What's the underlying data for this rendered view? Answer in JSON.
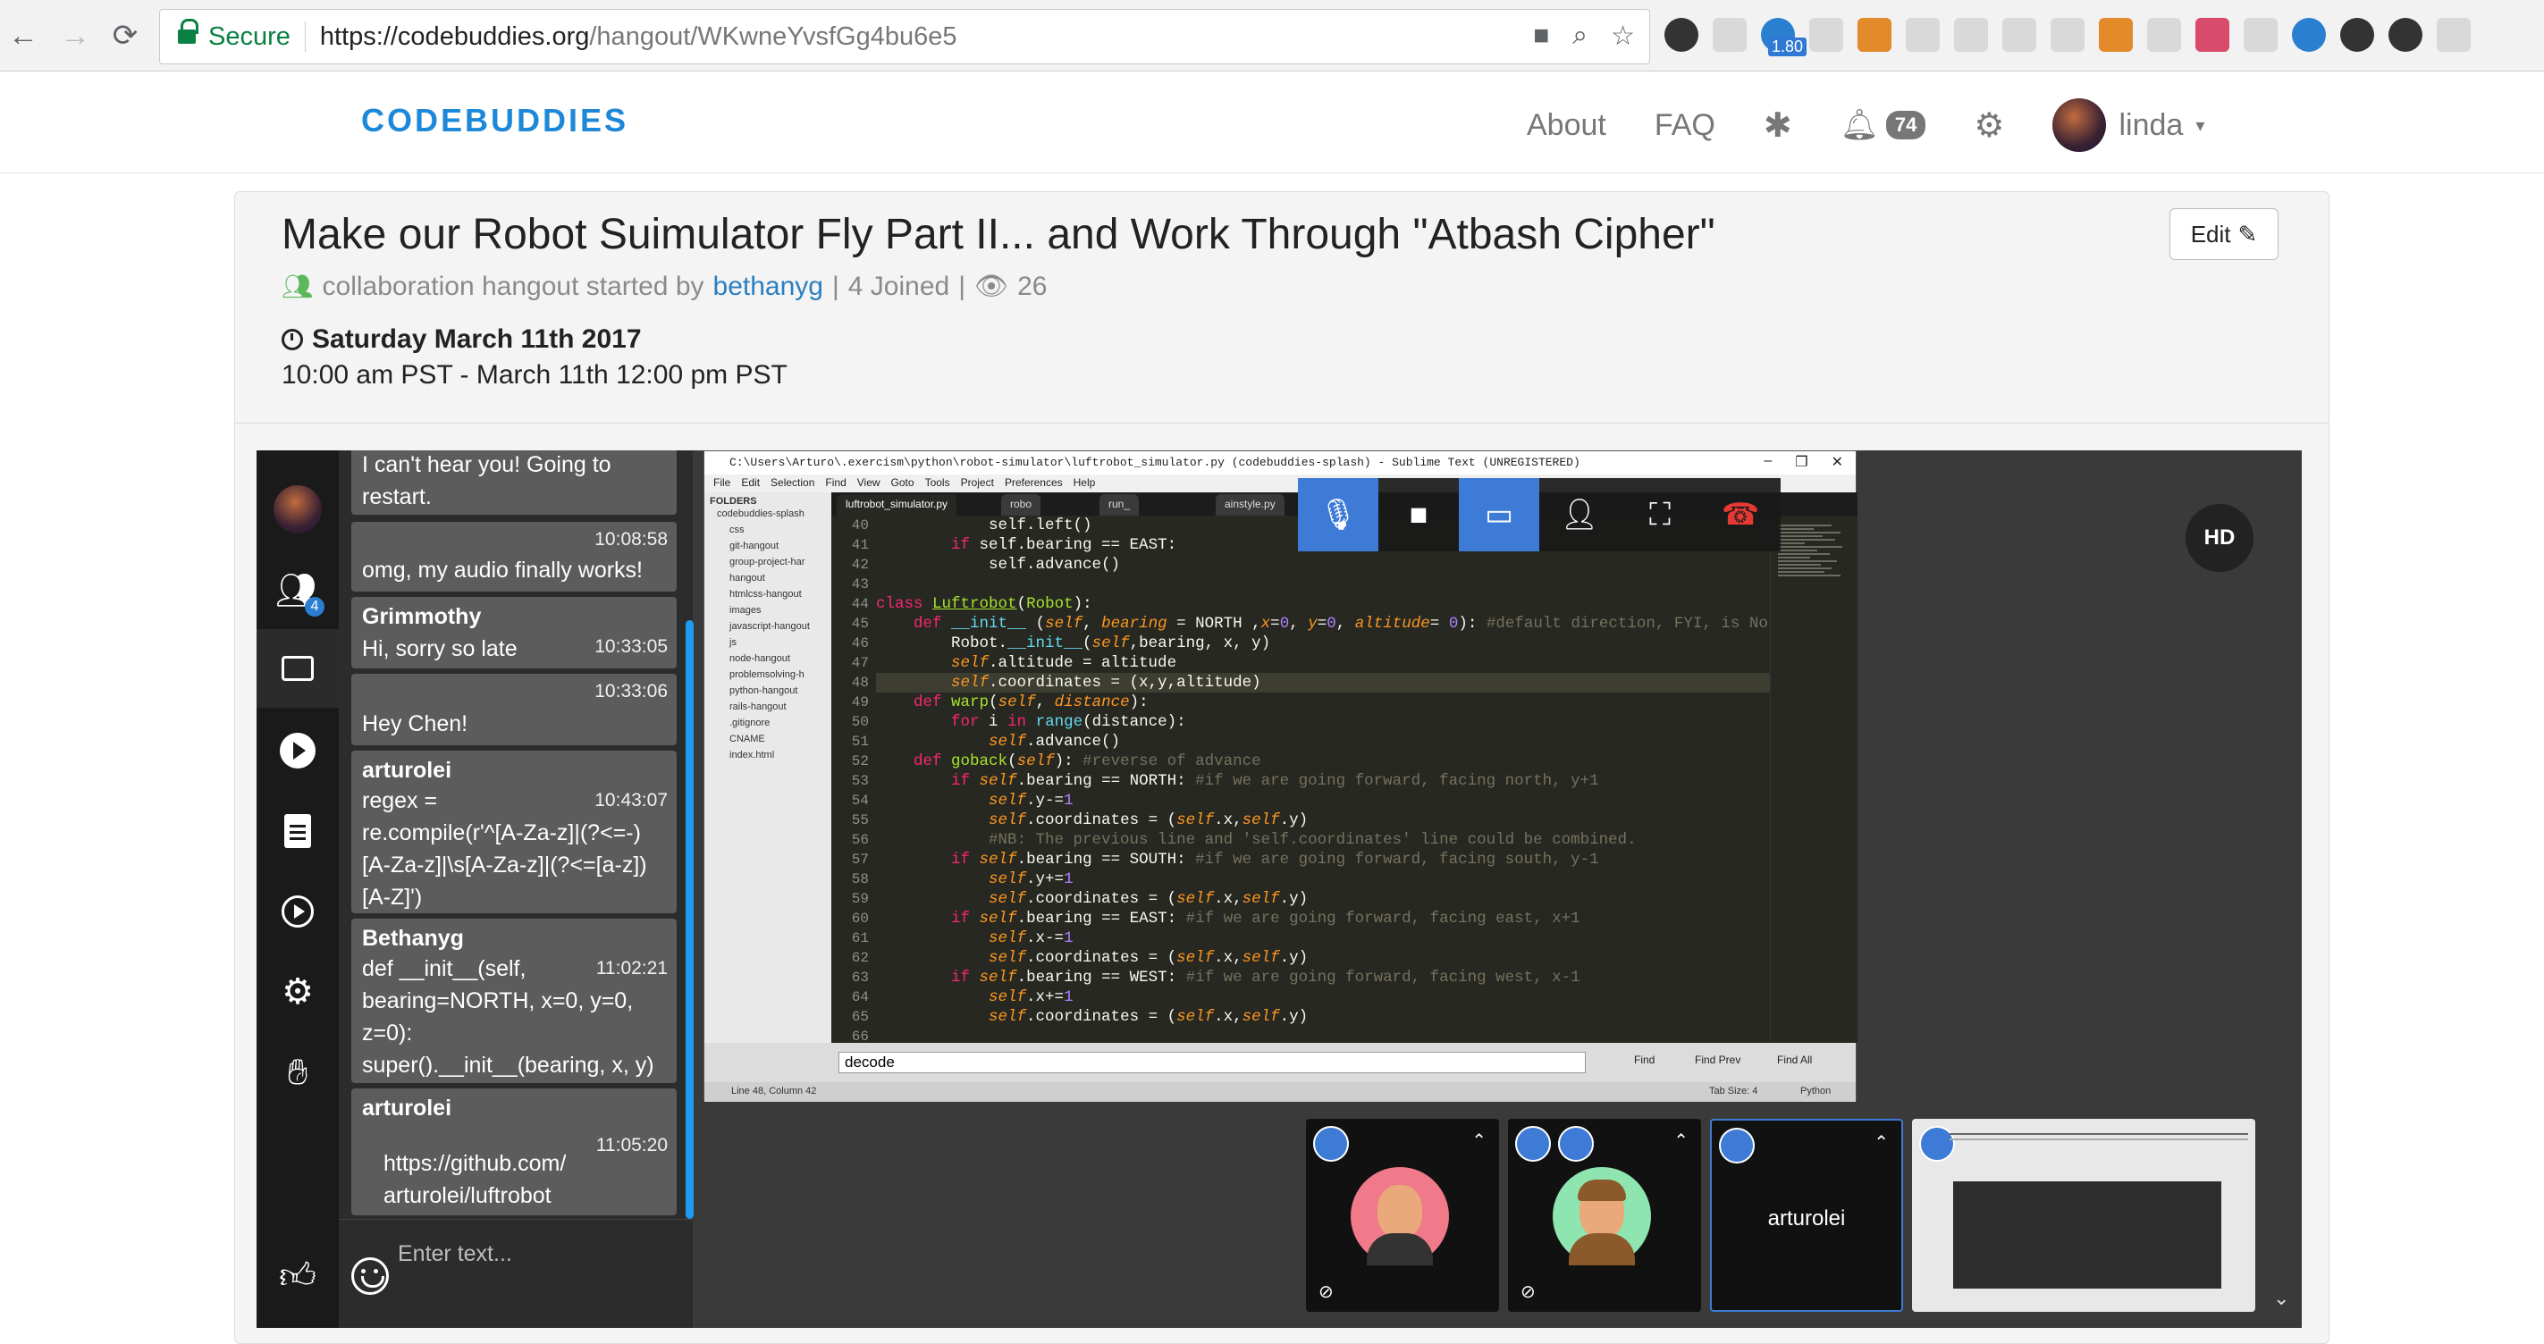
{
  "browser": {
    "secure_label": "Secure",
    "url_host": "https://codebuddies.org",
    "url_path": "/hangout/WKwneYvsfGg4bu6e5",
    "extension_badge": "1.80"
  },
  "header": {
    "logo": "CODEBUDDIES",
    "nav": {
      "about": "About",
      "faq": "FAQ"
    },
    "notifications_count": "74",
    "username": "linda"
  },
  "hangout": {
    "title": "Make our Robot Suimulator Fly Part II... and Work Through \"Atbash Cipher\"",
    "edit_label": "Edit",
    "type_text": "collaboration hangout started by",
    "host": "bethanyg",
    "separator": "|",
    "joined": "4 Joined",
    "views": "26",
    "date": "Saturday March 11th 2017",
    "time_range": "10:00 am PST - March 11th 12:00 pm PST"
  },
  "rail": {
    "participants_badge": "4"
  },
  "chat": {
    "messages": [
      {
        "name": "",
        "time": "",
        "lines": [
          "I can't hear you! Going to",
          "restart."
        ]
      },
      {
        "name": "",
        "time": "10:08:58",
        "lines": [
          "omg, my audio finally works!"
        ]
      },
      {
        "name": "Grimmothy",
        "time": "10:33:05",
        "lines": [
          "Hi, sorry so late"
        ]
      },
      {
        "name": "",
        "time": "10:33:06",
        "lines": [
          "Hey Chen!"
        ]
      },
      {
        "name": "arturolei",
        "time": "10:43:07",
        "lines": [
          "regex =",
          "re.compile(r'^[A-Za-z]|(?<=-)",
          "[A-Za-z]|\\s[A-Za-z]|(?<=[a-z])",
          "[A-Z]')"
        ]
      },
      {
        "name": "Bethanyg",
        "time": "11:02:21",
        "lines": [
          "def __init__(self,",
          "bearing=NORTH, x=0, y=0,",
          "z=0):",
          "super().__init__(bearing, x, y)"
        ]
      },
      {
        "name": "arturolei",
        "time": "11:05:20",
        "lines": [
          "https://github.com/",
          "arturolei/luftrobot"
        ]
      }
    ],
    "input_placeholder": "Enter text..."
  },
  "screen_share": {
    "window_title": "C:\\Users\\Arturo\\.exercism\\python\\robot-simulator\\luftrobot_simulator.py (codebuddies-splash) - Sublime Text (UNREGISTERED)",
    "menu": [
      "File",
      "Edit",
      "Selection",
      "Find",
      "View",
      "Goto",
      "Tools",
      "Project",
      "Preferences",
      "Help"
    ],
    "folders_label": "FOLDERS",
    "folders": [
      "codebuddies-splash",
      "css",
      "git-hangout",
      "group-project-har",
      "hangout",
      "htmlcss-hangout",
      "images",
      "javascript-hangout",
      "js",
      "node-hangout",
      "problemsolving-h",
      "python-hangout",
      "rails-hangout",
      ".gitignore",
      "CNAME",
      "index.html"
    ],
    "active_tab": "luftrobot_simulator.py",
    "other_tabs": [
      "robo",
      "run_",
      "ainstyle.py"
    ],
    "line_numbers": [
      "40",
      "41",
      "42",
      "43",
      "44",
      "45",
      "46",
      "47",
      "48",
      "49",
      "50",
      "51",
      "52",
      "53",
      "54",
      "55",
      "56",
      "57",
      "58",
      "59",
      "60",
      "61",
      "62",
      "63",
      "64",
      "65",
      "66"
    ],
    "find_value": "decode",
    "find_buttons": [
      "Find",
      "Find Prev",
      "Find All"
    ],
    "status_left": "Line 48, Column 42",
    "status_tab": "Tab Size: 4",
    "status_lang": "Python"
  },
  "video": {
    "hd_label": "HD",
    "tiles": [
      {
        "name": ""
      },
      {
        "name": ""
      },
      {
        "name": "arturolei"
      },
      {
        "name": ""
      }
    ]
  }
}
